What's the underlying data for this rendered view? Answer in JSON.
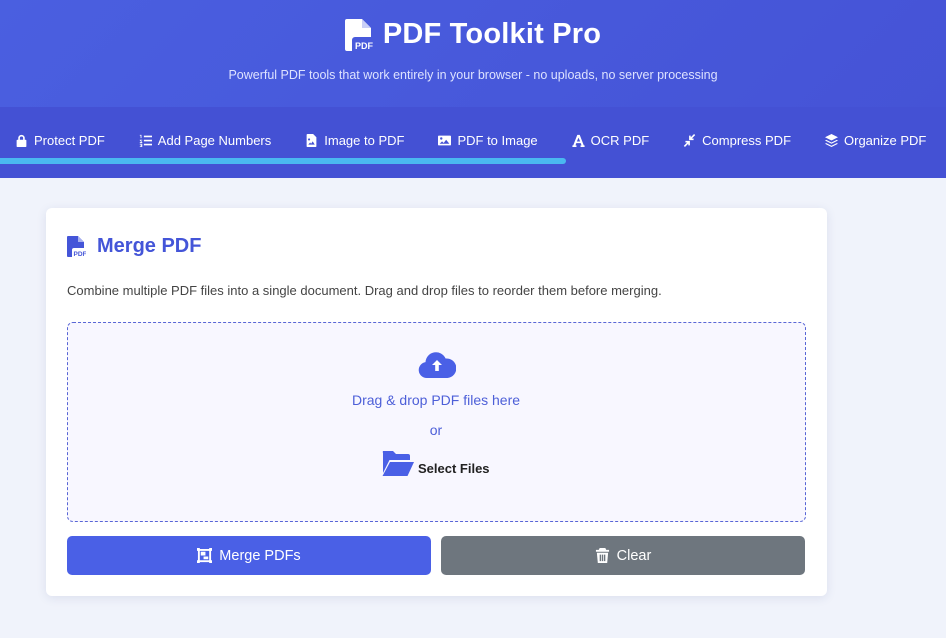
{
  "header": {
    "title": "PDF Toolkit Pro",
    "subtitle": "Powerful PDF tools that work entirely in your browser - no uploads, no server processing",
    "icon": "file-pdf-icon"
  },
  "nav": {
    "tabs": [
      {
        "label": "Protect PDF",
        "icon": "lock-icon"
      },
      {
        "label": "Add Page Numbers",
        "icon": "list-ol-icon"
      },
      {
        "label": "Image to PDF",
        "icon": "file-image-icon"
      },
      {
        "label": "PDF to Image",
        "icon": "image-icon"
      },
      {
        "label": "OCR PDF",
        "icon": "font-icon"
      },
      {
        "label": "Compress PDF",
        "icon": "compress-icon"
      },
      {
        "label": "Organize PDF",
        "icon": "layers-icon"
      }
    ]
  },
  "card": {
    "title": "Merge PDF",
    "description": "Combine multiple PDF files into a single document. Drag and drop files to reorder them before merging.",
    "dropzone": {
      "text": "Drag & drop PDF files here",
      "or": "or",
      "select_label": "Select Files"
    },
    "merge_label": "Merge PDFs",
    "clear_label": "Clear"
  },
  "colors": {
    "header_bg": "#4a5fe0",
    "nav_bg": "#4451d4",
    "accent": "#4a60e6",
    "clear_bg": "#6e767e",
    "indicator": "#4ab8f0"
  }
}
